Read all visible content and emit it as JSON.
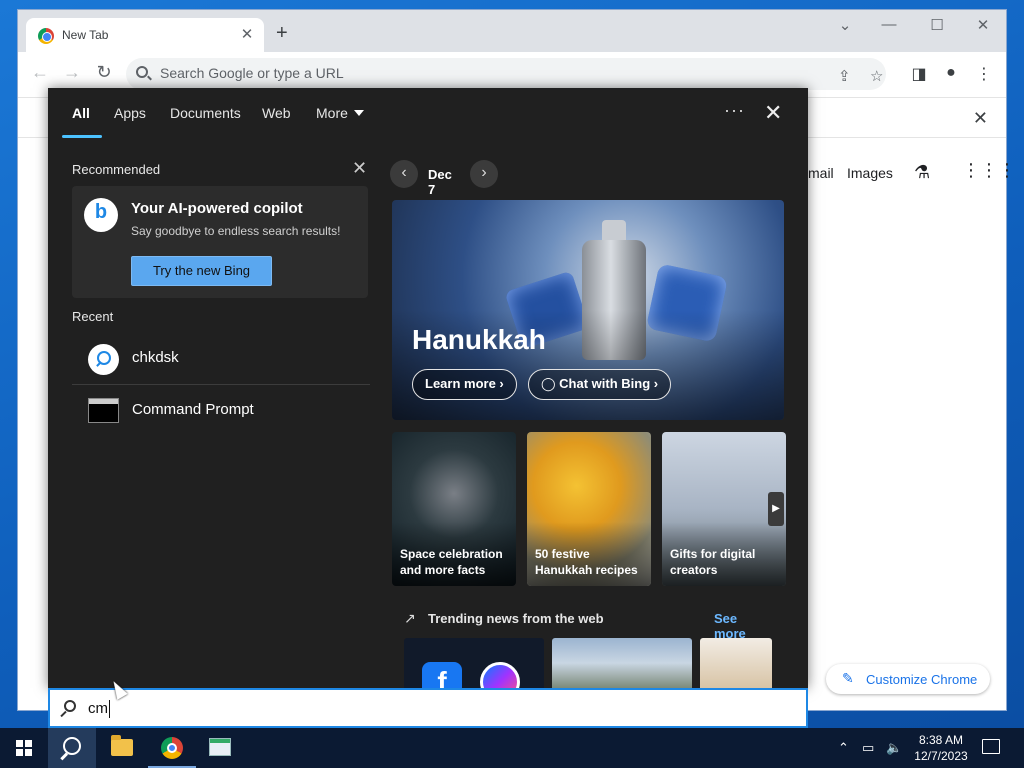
{
  "browser": {
    "tab_title": "New Tab",
    "tab_close": "✕",
    "new_tab": "+",
    "omnibox_placeholder": "Search Google or type a URL",
    "ntp_links": [
      "mail",
      "Images"
    ],
    "customize_label": "Customize Chrome",
    "icons": [
      "back-icon",
      "forward-icon",
      "reload-icon",
      "share-icon",
      "star-icon",
      "side-panel-icon",
      "profile-icon",
      "menu-icon",
      "labs-icon",
      "apps-grid-icon"
    ]
  },
  "search_panel": {
    "tabs": [
      "All",
      "Apps",
      "Documents",
      "Web",
      "More"
    ],
    "active_tab": "All",
    "recommended": {
      "title": "Recommended",
      "card_title": "Your AI-powered copilot",
      "card_subtitle": "Say goodbye to endless search results!",
      "card_button": "Try the new Bing"
    },
    "recent": {
      "title": "Recent",
      "items": [
        {
          "label": "chkdsk",
          "icon": "search-icon"
        },
        {
          "label": "Command Prompt",
          "icon": "command-prompt-icon"
        }
      ]
    },
    "highlights": {
      "date": "Dec 7",
      "hero_title": "Hanukkah",
      "hero_buttons": [
        "Learn more",
        "Chat with Bing"
      ],
      "cards": [
        {
          "line1": "Space celebration",
          "line2": "and more facts"
        },
        {
          "line1": "50 festive",
          "line2": "Hanukkah recipes"
        },
        {
          "line1": "Gifts for digital",
          "line2": "creators"
        }
      ],
      "trending_title": "Trending news from the web",
      "see_more": "See more"
    },
    "query": "cm"
  },
  "taskbar": {
    "clock_time": "8:38 AM",
    "clock_date": "12/7/2023"
  },
  "colors": {
    "panel_bg": "#202020",
    "accent": "#4cc2ff",
    "bing_button": "#5aa7ef",
    "link_blue": "#6cb8ff",
    "taskbar": "#0b1a33"
  }
}
